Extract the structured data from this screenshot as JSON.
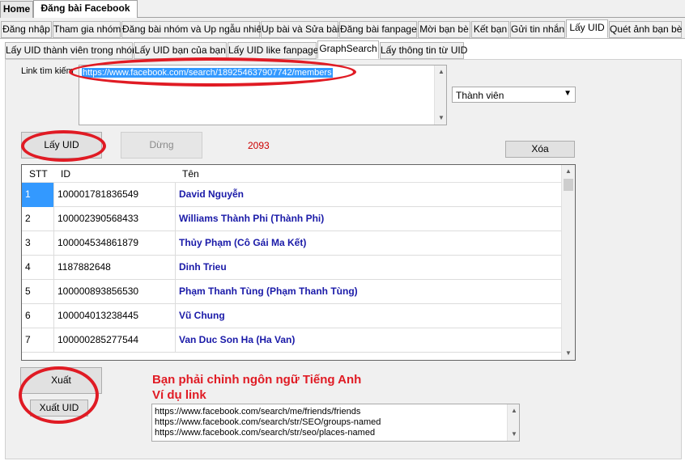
{
  "top_tabs": [
    "Home",
    "Đăng bài Facebook"
  ],
  "main_tabs": [
    "Đăng nhập",
    "Tham gia nhóm",
    "Đăng bài nhóm và Up ngẫu nhiên",
    "Up bài và Sửa bài",
    "Đăng bài fanpage",
    "Mời bạn bè",
    "Kết bạn",
    "Gửi tin nhắn",
    "Lấy UID",
    "Quét ảnh bạn bè"
  ],
  "sub_tabs": [
    "Lấy UID thành viên trong nhóm",
    "Lấy UID bạn của bạn",
    "Lấy UID like fanpage",
    "GraphSearch",
    "Lấy thông tin từ UID"
  ],
  "link_label": "Link tìm kiếm",
  "link_value": "https://www.facebook.com/search/189254637907742/members",
  "member_select": "Thành viên",
  "get_uid_button": "Lấy UID",
  "stop_button": "Dừng",
  "count": "2093",
  "delete_button": "Xóa",
  "grid": {
    "headers": [
      "STT",
      "ID",
      "Tên"
    ],
    "rows": [
      {
        "stt": "1",
        "id": "100001781836549",
        "name": "David Nguyễn"
      },
      {
        "stt": "2",
        "id": "100002390568433",
        "name": "Williams Thành Phi  (Thành Phi)"
      },
      {
        "stt": "3",
        "id": "100004534861879",
        "name": "Thủy Phạm  (Cô Gái Ma Kết)"
      },
      {
        "stt": "4",
        "id": "1187882648",
        "name": "Dinh Trieu"
      },
      {
        "stt": "5",
        "id": "100000893856530",
        "name": "Phạm Thanh Tùng  (Phạm Thanh Tùng)"
      },
      {
        "stt": "6",
        "id": "100004013238445",
        "name": "Vũ Chung"
      },
      {
        "stt": "7",
        "id": "100000285277544",
        "name": "Van Duc Son Ha  (Ha Van)"
      }
    ]
  },
  "export_button": "Xuất",
  "export_uid_button": "Xuất UID",
  "note_line1": "Bạn phải chỉnh ngôn ngữ Tiếng Anh",
  "note_line2": "Ví dụ link",
  "example_links": [
    "https://www.facebook.com/search/me/friends/friends",
    "https://www.facebook.com/search/str/SEO/groups-named",
    "https://www.facebook.com/search/str/seo/places-named"
  ],
  "colors": {
    "annotation": "#e01b24",
    "name_text": "#1a1aa8",
    "selection": "#3399ff",
    "count": "#cc0000"
  }
}
